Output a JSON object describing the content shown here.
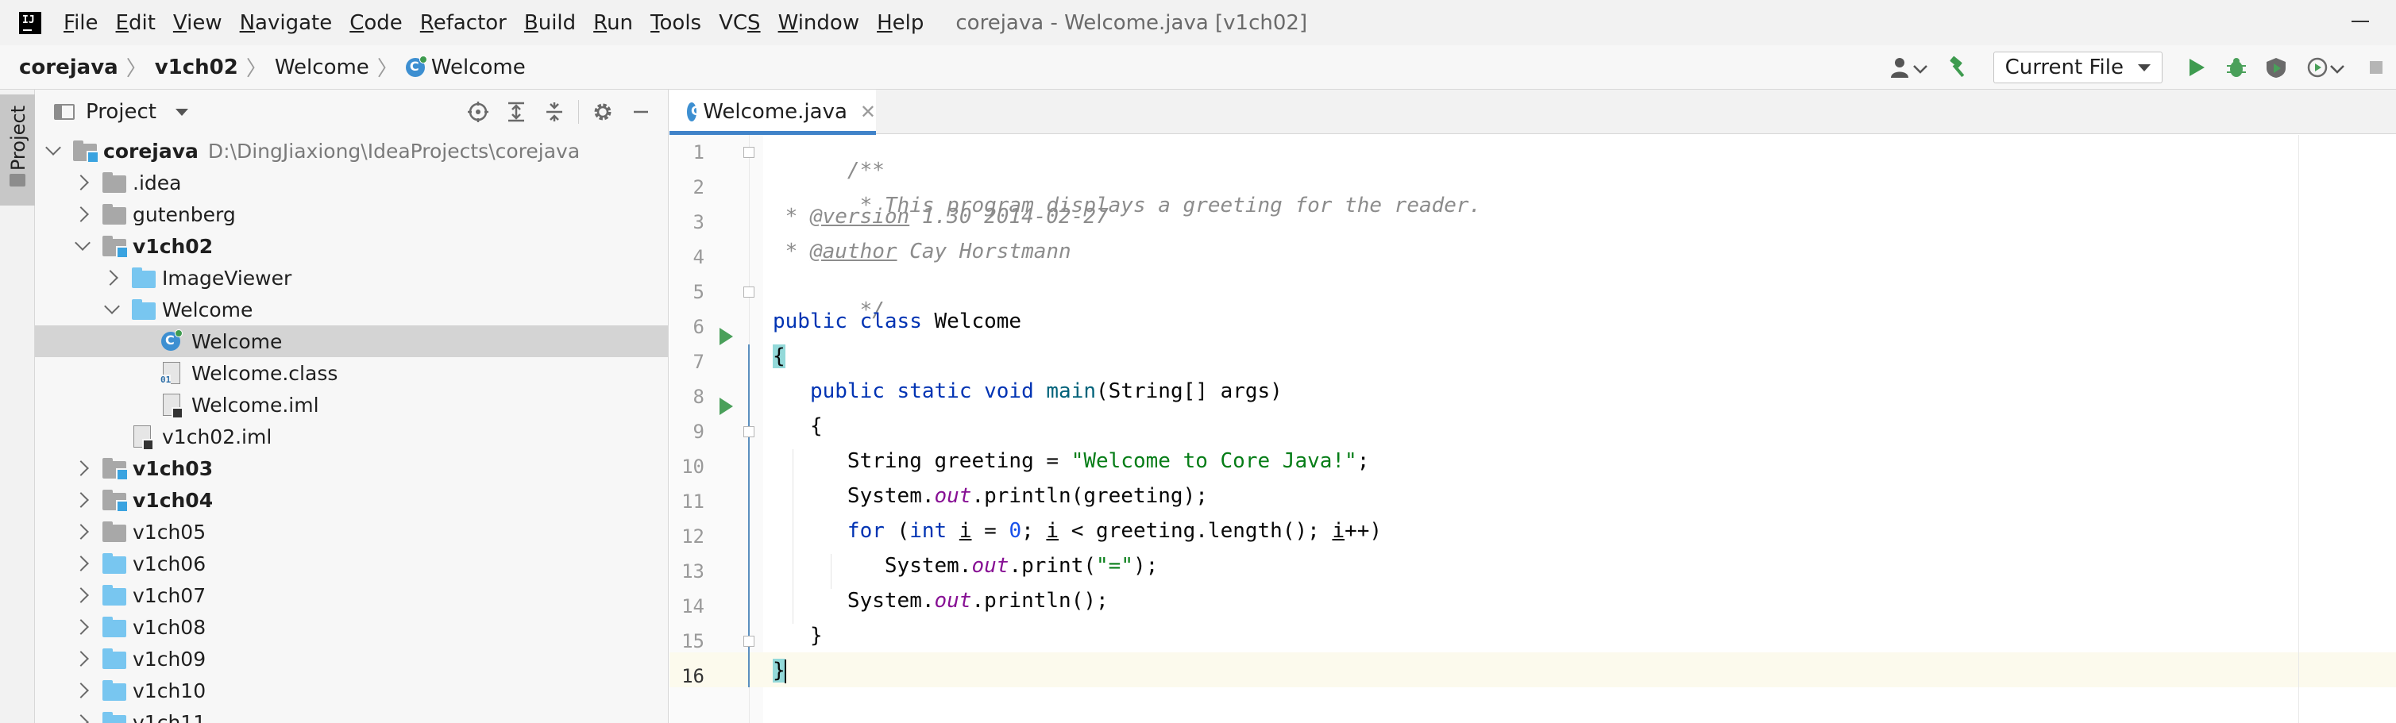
{
  "window": {
    "title": "corejava - Welcome.java [v1ch02]"
  },
  "menu": [
    {
      "label": "File",
      "mnemonic": "F",
      "rest": "ile"
    },
    {
      "label": "Edit",
      "mnemonic": "E",
      "rest": "dit"
    },
    {
      "label": "View",
      "mnemonic": "V",
      "rest": "iew"
    },
    {
      "label": "Navigate",
      "mnemonic": "N",
      "rest": "avigate"
    },
    {
      "label": "Code",
      "mnemonic": "C",
      "rest": "ode"
    },
    {
      "label": "Refactor",
      "mnemonic": "R",
      "rest": "efactor"
    },
    {
      "label": "Build",
      "mnemonic": "B",
      "rest": "uild"
    },
    {
      "label": "Run",
      "mnemonic": "R",
      "rest": "un"
    },
    {
      "label": "Tools",
      "mnemonic": "T",
      "rest": "ools"
    },
    {
      "label": "VCS",
      "mnemonic": "S",
      "rest": ""
    },
    {
      "label": "Window",
      "mnemonic": "W",
      "rest": "indow"
    },
    {
      "label": "Help",
      "mnemonic": "H",
      "rest": "elp"
    }
  ],
  "breadcrumb": [
    "corejava",
    "v1ch02",
    "Welcome",
    "Welcome"
  ],
  "toolbar": {
    "run_config": "Current File"
  },
  "project_panel": {
    "stripe_label": "Project",
    "title": "Project",
    "tree": [
      {
        "label": "corejava",
        "path": "D:\\DingJiaxiong\\IdeaProjects\\corejava",
        "bold": true,
        "arrow": "expanded",
        "icon": "module-folder"
      },
      {
        "label": ".idea",
        "arrow": "collapsed",
        "icon": "grey-folder"
      },
      {
        "label": "gutenberg",
        "arrow": "collapsed",
        "icon": "grey-folder"
      },
      {
        "label": "v1ch02",
        "bold": true,
        "arrow": "expanded",
        "icon": "module-folder"
      },
      {
        "label": "ImageViewer",
        "arrow": "collapsed",
        "icon": "blue-folder"
      },
      {
        "label": "Welcome",
        "arrow": "expanded",
        "icon": "blue-folder"
      },
      {
        "label": "Welcome",
        "icon": "java-class",
        "selected": true
      },
      {
        "label": "Welcome.class",
        "icon": "class-file"
      },
      {
        "label": "Welcome.iml",
        "icon": "iml-file"
      },
      {
        "label": "v1ch02.iml",
        "icon": "iml-file"
      },
      {
        "label": "v1ch03",
        "bold": true,
        "arrow": "collapsed",
        "icon": "module-folder"
      },
      {
        "label": "v1ch04",
        "bold": true,
        "arrow": "collapsed",
        "icon": "module-folder"
      },
      {
        "label": "v1ch05",
        "arrow": "collapsed",
        "icon": "grey-folder"
      },
      {
        "label": "v1ch06",
        "arrow": "collapsed",
        "icon": "blue-folder"
      },
      {
        "label": "v1ch07",
        "arrow": "collapsed",
        "icon": "blue-folder"
      },
      {
        "label": "v1ch08",
        "arrow": "collapsed",
        "icon": "blue-folder"
      },
      {
        "label": "v1ch09",
        "arrow": "collapsed",
        "icon": "blue-folder"
      },
      {
        "label": "v1ch10",
        "arrow": "collapsed",
        "icon": "blue-folder"
      },
      {
        "label": "v1ch11",
        "arrow": "collapsed",
        "icon": "blue-folder"
      }
    ]
  },
  "editor": {
    "tab_label": "Welcome.java",
    "current_line": 16,
    "lines": [
      {
        "n": "1",
        "code": "/**"
      },
      {
        "n": "2",
        "code": " * This program displays a greeting for the reader."
      },
      {
        "n": "3",
        "code": " * @version 1.30 2014-02-27"
      },
      {
        "n": "4",
        "code": " * @author Cay Horstmann"
      },
      {
        "n": "5",
        "code": " */"
      },
      {
        "n": "6",
        "code": "public class Welcome"
      },
      {
        "n": "7",
        "code": "{"
      },
      {
        "n": "8",
        "code": "   public static void main(String[] args)"
      },
      {
        "n": "9",
        "code": "   {"
      },
      {
        "n": "10",
        "code": "      String greeting = \"Welcome to Core Java!\";"
      },
      {
        "n": "11",
        "code": "      System.out.println(greeting);"
      },
      {
        "n": "12",
        "code": "      for (int i = 0; i < greeting.length(); i++)"
      },
      {
        "n": "13",
        "code": "         System.out.print(\"=\");"
      },
      {
        "n": "14",
        "code": "      System.out.println();"
      },
      {
        "n": "15",
        "code": "   }"
      },
      {
        "n": "16",
        "code": "}"
      }
    ],
    "spans": {
      "l1": "/**",
      "l2": " * This program displays a greeting for the reader.",
      "l3_pre": " * ",
      "l3_tag": "@version",
      "l3_post": " 1.30 2014-02-27",
      "l4_pre": " * ",
      "l4_tag": "@author",
      "l4_post": " Cay Horstmann",
      "l5": " */",
      "kw_public": "public",
      "kw_class": "class",
      "cls_name": " Welcome",
      "brace_open": "{",
      "brace_close": "}",
      "kw_static": "static",
      "kw_void": "void",
      "m_main": "main",
      "main_args": "(String[] args)",
      "l10_a": "String greeting = ",
      "l10_str": "\"Welcome to Core Java!\"",
      "l10_b": ";",
      "sys": "System.",
      "out": "out",
      "println_greeting": ".println(greeting);",
      "kw_for": "for",
      "paren": " (",
      "kw_int": "int",
      "var_i": "i",
      "eq": " = ",
      "zero": "0",
      "semi": "; ",
      "cmp": " < greeting.length(); ",
      "inc": "++)",
      "print_a": ".print(",
      "print_str": "\"=\"",
      "print_b": ");",
      "println_empty": ".println();"
    }
  }
}
